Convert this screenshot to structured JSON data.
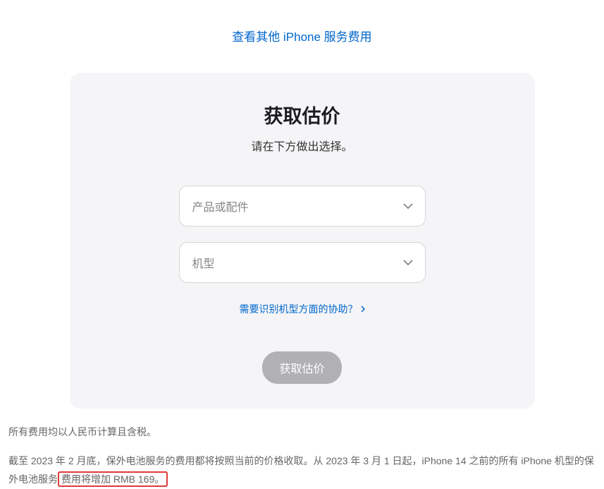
{
  "topLink": "查看其他 iPhone 服务费用",
  "card": {
    "title": "获取估价",
    "subtitle": "请在下方做出选择。",
    "select1_placeholder": "产品或配件",
    "select2_placeholder": "机型",
    "helpLink": "需要识别机型方面的协助？",
    "submitLabel": "获取估价"
  },
  "footer": {
    "line1": "所有费用均以人民币计算且含税。",
    "line2_part1": "截至 2023 年 2 月底，保外电池服务的费用都将按照当前的价格收取。从 2023 年 3 月 1 日起，iPhone 14 之前的所有 iPhone 机型的保外电池服",
    "line2_part2": "务",
    "line2_highlight": "费用将增加 RMB 169。"
  }
}
